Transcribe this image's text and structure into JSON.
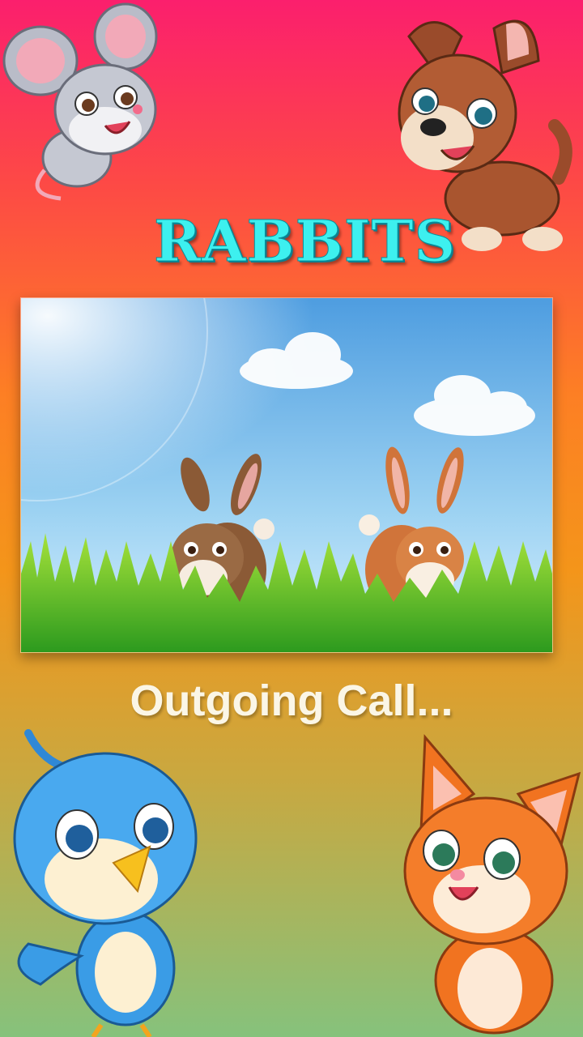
{
  "screen": {
    "animal_name": "RABBITS",
    "call_status": "Outgoing Call..."
  },
  "decorations": {
    "top_left": "mouse-cartoon",
    "top_right": "puppy-cartoon",
    "bottom_left": "bluebird-cartoon",
    "bottom_right": "kitten-cartoon",
    "center_photo": "two-rabbits-in-grass"
  },
  "colors": {
    "title": "#3df0ef",
    "status_text": "#fbf6e6",
    "bg_top": "#fb1f6d",
    "bg_bottom": "#86c27c"
  }
}
